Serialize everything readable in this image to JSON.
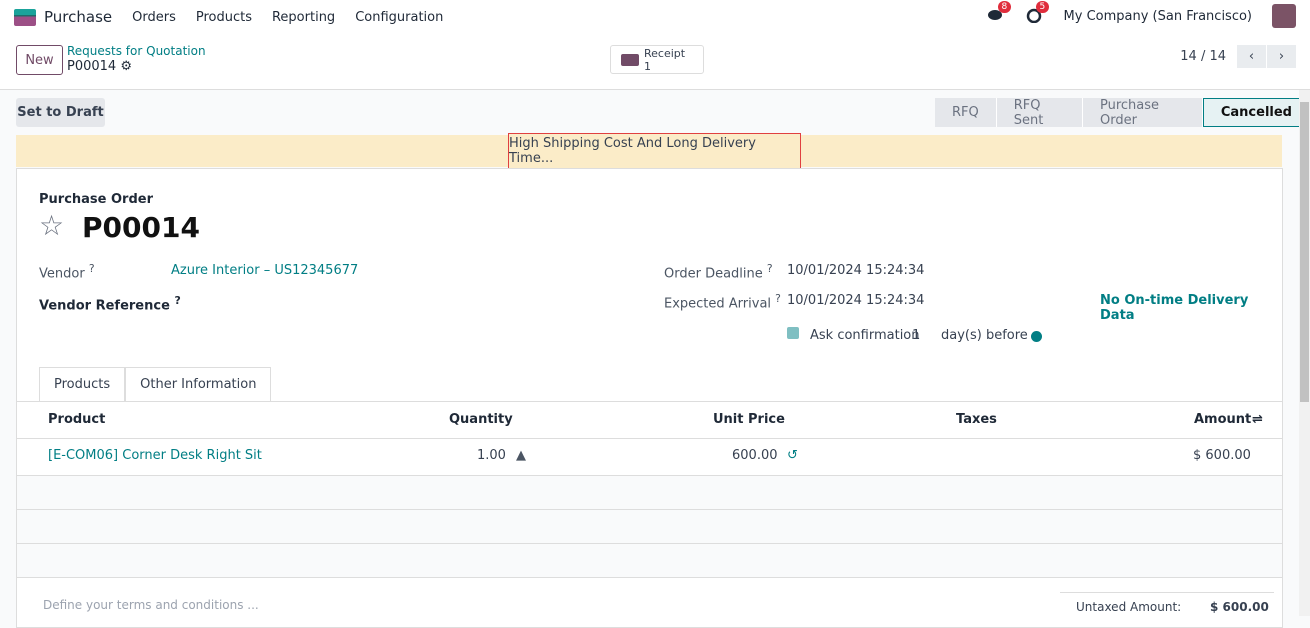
{
  "nav": {
    "app": "Purchase",
    "menu": [
      "Orders",
      "Products",
      "Reporting",
      "Configuration"
    ],
    "messages_badge": "8",
    "activities_badge": "5",
    "company": "My Company (San Francisco)"
  },
  "control": {
    "new": "New",
    "breadcrumb": "Requests for Quotation",
    "record": "P00014",
    "receipt_label": "Receipt",
    "receipt_count": "1",
    "pager": "14 / 14"
  },
  "actions": {
    "set_to_draft": "Set to Draft"
  },
  "statusbar": [
    "RFQ",
    "RFQ Sent",
    "Purchase Order",
    "Cancelled"
  ],
  "alert": "High Shipping Cost And Long Delivery Time...",
  "form": {
    "type_label": "Purchase Order",
    "name": "P00014",
    "vendor_label": "Vendor",
    "vendor": "Azure Interior – US12345677",
    "vendor_ref_label": "Vendor Reference",
    "deadline_label": "Order Deadline",
    "deadline": "10/01/2024 15:24:34",
    "arrival_label": "Expected Arrival",
    "arrival": "10/01/2024 15:24:34",
    "ontime": "No On-time Delivery Data",
    "ask_conf": "Ask confirmation",
    "ask_days": "1",
    "days_before": "day(s) before",
    "tooltip_mark": "?"
  },
  "tabs": [
    "Products",
    "Other Information"
  ],
  "table": {
    "headers": [
      "Product",
      "Quantity",
      "Unit Price",
      "Taxes",
      "Amount"
    ],
    "rows": [
      {
        "product": "[E-COM06] Corner Desk Right Sit",
        "quantity": "1.00",
        "unit_price": "600.00",
        "taxes": "",
        "amount": "$ 600.00"
      }
    ]
  },
  "footer": {
    "terms_placeholder": "Define your terms and conditions ...",
    "untaxed_label": "Untaxed Amount:",
    "untaxed": "$ 600.00"
  }
}
